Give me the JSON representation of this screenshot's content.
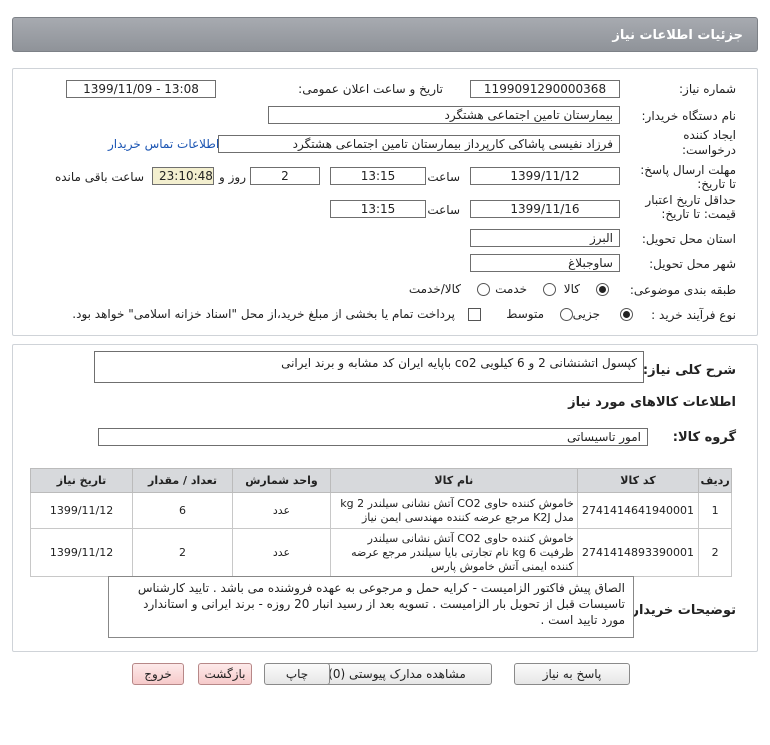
{
  "header": {
    "title": "جزئیات اطلاعات نیاز"
  },
  "form": {
    "need_number_label": "شماره نیاز:",
    "need_number": "1199091290000368",
    "announce_label": "تاریخ و ساعت اعلان عمومی:",
    "announce_value": "1399/11/09 - 13:08",
    "buyer_org_label": "نام دستگاه خریدار:",
    "buyer_org": "بیمارستان تامین اجتماعی هشتگرد",
    "creator_label": "ایجاد کننده درخواست:",
    "creator": "فرزاد  نفیسی پاشاکی کارپرداز بیمارستان تامین اجتماعی هشتگرد",
    "contact_link": "اطلاعات تماس خریدار",
    "reply_deadline_label": "مهلت ارسال پاسخ:",
    "reply_deadline_sub": "تا تاریخ:",
    "reply_date": "1399/11/12",
    "time_label": "ساعت",
    "reply_time": "13:15",
    "days_value": "2",
    "days_label": "روز و",
    "remaining_time": "23:10:48",
    "remaining_label": "ساعت باقی مانده",
    "validity_label": "حداقل تاریخ اعتبار",
    "validity_sub": "قیمت: تا تاریخ:",
    "validity_date": "1399/11/16",
    "validity_time": "13:15",
    "province_label": "استان محل تحویل:",
    "province": "البرز",
    "city_label": "شهر محل تحویل:",
    "city": "ساوجبلاغ",
    "category_label": "طبقه بندی موضوعی:",
    "category_options": [
      "کالا",
      "خدمت",
      "کالا/خدمت"
    ],
    "purchase_type_label": "نوع فرآیند خرید :",
    "purchase_options": [
      "جزیی",
      "متوسط"
    ],
    "treasury_note": "پرداخت تمام یا بخشی از مبلغ خرید،از محل \"اسناد خزانه اسلامی\" خواهد بود."
  },
  "summary": {
    "label": "شرح کلی نیاز:",
    "text": "کپسول اتشنشانی 2 و 6 کیلویی co2   باپایه  ایران کد مشابه و برند ایرانی"
  },
  "goods": {
    "section_title": "اطلاعات کالاهای مورد نیاز",
    "group_label": "گروه کالا:",
    "group_value": "امور تاسیساتی",
    "columns": [
      "ردیف",
      "کد کالا",
      "نام کالا",
      "واحد شمارش",
      "تعداد / مقدار",
      "تاریخ نیاز"
    ],
    "rows": [
      {
        "index": "1",
        "code": "2741414641940001",
        "name": "خاموش کننده حاوی CO2 آتش نشانی سیلندر 2 kg مدل K2J مرجع عرضه کننده مهندسی ایمن نیاز",
        "unit": "عدد",
        "qty": "6",
        "date": "1399/11/12"
      },
      {
        "index": "2",
        "code": "2741414893390001",
        "name": "خاموش کننده حاوی CO2 آتش نشانی سیلندر ظرفیت 6 kg نام تجارتی بایا سیلندر مرجع عرضه کننده ایمنی آتش خاموش پارس",
        "unit": "عدد",
        "qty": "2",
        "date": "1399/11/12"
      }
    ]
  },
  "buyer_notes": {
    "label": "توضیحات خریدار:",
    "text": "الصاق پیش فاکتور الزامیست - کرایه حمل و مرجوعی به عهده فروشنده می باشد . تایید کارشناس تاسیسات قبل از تحویل بار الزامیست . تسویه بعد از رسید انبار 20 روزه - برند ایرانی و استاندارد مورد تایید  است ."
  },
  "buttons": {
    "reply": "پاسخ به نیاز",
    "attachments": "مشاهده مدارک پیوستی (0)",
    "print": "چاپ",
    "back": "بازگشت",
    "exit": "خروج"
  },
  "colors": {
    "titlebar": "#9a9ea4",
    "link": "#1b55b3",
    "remaining_bg": "#f3efcf"
  }
}
